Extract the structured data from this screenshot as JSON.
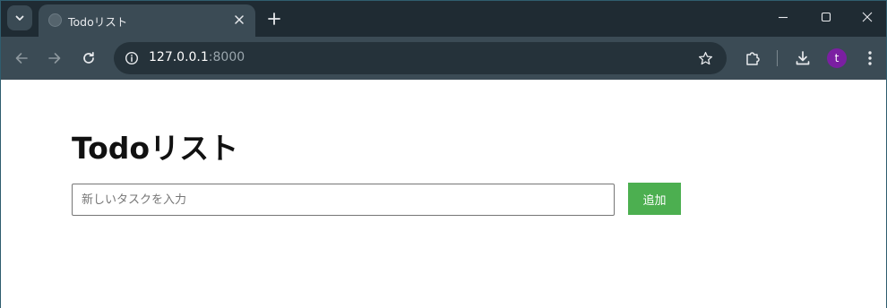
{
  "browser": {
    "tab": {
      "title": "Todoリスト"
    },
    "address_bar": {
      "host": "127.0.0.1",
      "port": ":8000"
    },
    "profile": {
      "initial": "t",
      "color": "#7b1fa2"
    },
    "colors": {
      "tabstrip": "#1f2b33",
      "toolbar": "#3b4b55",
      "omnibox": "#25323a"
    }
  },
  "page": {
    "title": "Todoリスト",
    "input": {
      "placeholder": "新しいタスクを入力",
      "value": ""
    },
    "add_button_label": "追加",
    "accent_color": "#4caf50"
  }
}
